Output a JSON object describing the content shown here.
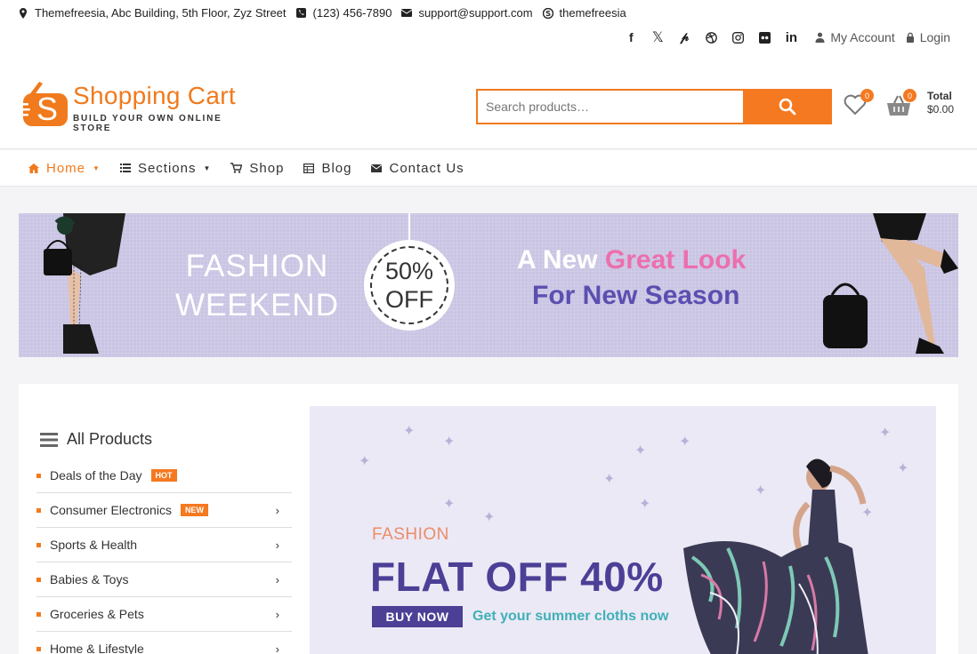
{
  "topbar": {
    "address": "Themefreesia, Abc Building, 5th Floor, Zyz Street",
    "phone": "(123) 456-7890",
    "email": "support@support.com",
    "skype": "themefreesia",
    "social": [
      "facebook-icon",
      "x-icon",
      "pinterest-icon",
      "dribbble-icon",
      "instagram-icon",
      "flickr-icon",
      "linkedin-icon"
    ],
    "my_account": "My Account",
    "login": "Login"
  },
  "header": {
    "logo_title": "Shopping Cart",
    "logo_tagline": "BUILD YOUR OWN ONLINE STORE",
    "search_placeholder": "Search products…",
    "wishlist_count": "0",
    "cart_count": "0",
    "total_label": "Total",
    "total_value": "$0.00"
  },
  "nav": {
    "items": [
      {
        "label": "Home",
        "icon": "home-icon"
      },
      {
        "label": "Sections",
        "icon": "sections-icon"
      },
      {
        "label": "Shop",
        "icon": "cart-icon"
      },
      {
        "label": "Blog",
        "icon": "blog-icon"
      },
      {
        "label": "Contact Us",
        "icon": "mail-icon"
      }
    ]
  },
  "banner": {
    "left_line1": "FASHION",
    "left_line2": "WEEKEND",
    "off_line1": "50%",
    "off_line2": "OFF",
    "right_line1_a": "A New ",
    "right_line1_b": "Great Look",
    "right_line2": "For New Season"
  },
  "categories": {
    "heading": "All Products",
    "items": [
      {
        "label": "Deals of the Day",
        "tag": "HOT"
      },
      {
        "label": "Consumer Electronics",
        "tag": "NEW"
      },
      {
        "label": "Sports & Health",
        "tag": ""
      },
      {
        "label": "Babies & Toys",
        "tag": ""
      },
      {
        "label": "Groceries & Pets",
        "tag": ""
      },
      {
        "label": "Home & Lifestyle",
        "tag": ""
      }
    ]
  },
  "promo": {
    "subtitle": "FASHION",
    "title": "FLAT OFF 40%",
    "button": "BUY NOW",
    "note": "Get your summer cloths now"
  },
  "colors": {
    "accent": "#f47920",
    "purple": "#4b3f96",
    "pink": "#ec6fae"
  }
}
